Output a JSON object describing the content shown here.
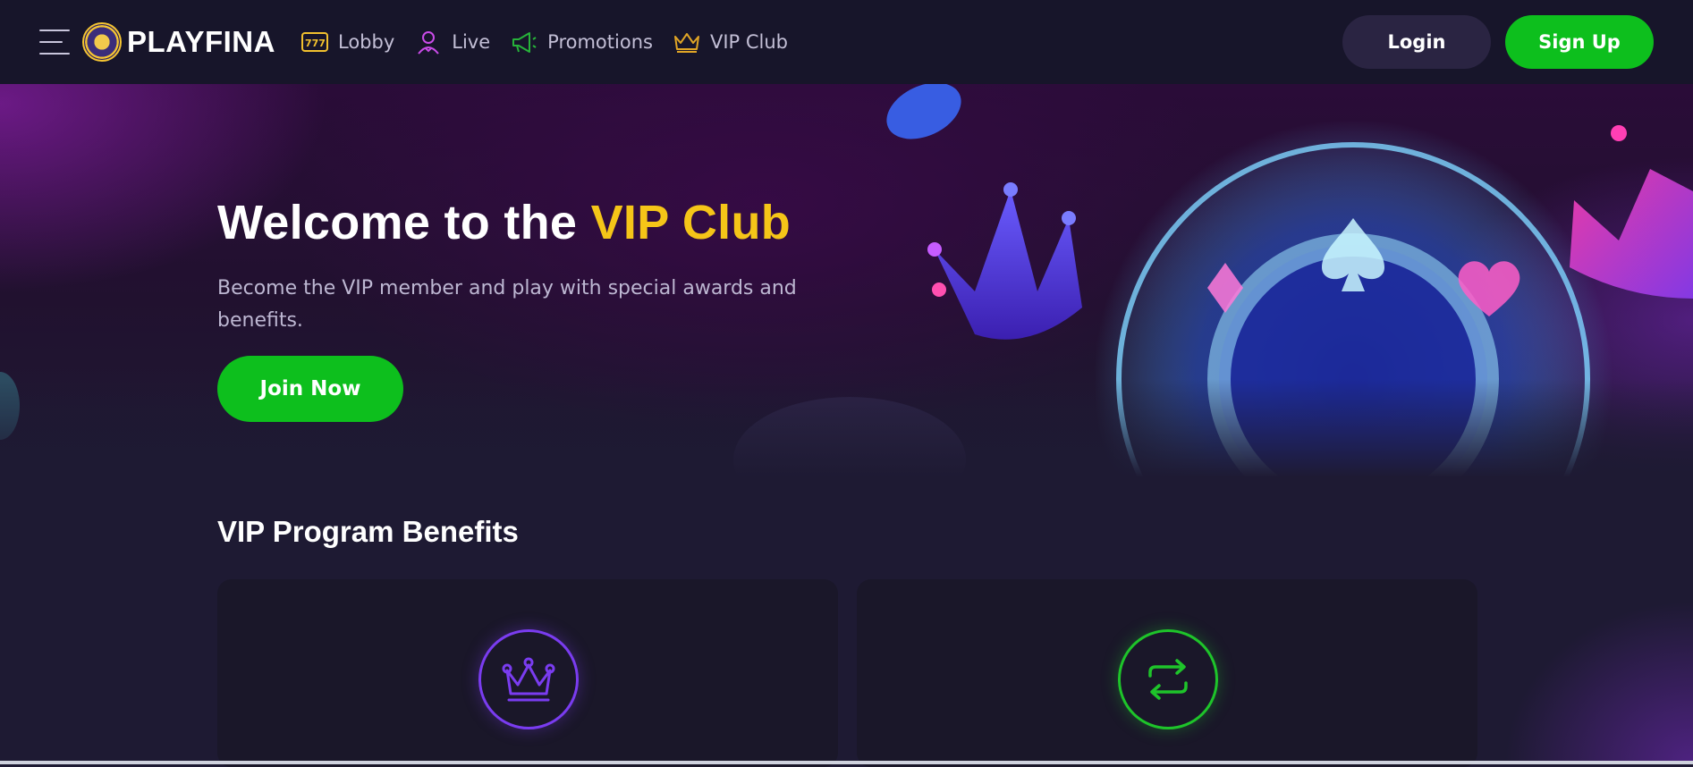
{
  "brand": {
    "name": "PLAYFINA"
  },
  "nav": {
    "items": [
      {
        "label": "Lobby",
        "icon": "slot-machine-icon",
        "color": "#f2c12e"
      },
      {
        "label": "Live",
        "icon": "dealer-icon",
        "color": "#c94be8"
      },
      {
        "label": "Promotions",
        "icon": "megaphone-icon",
        "color": "#27b33a"
      },
      {
        "label": "VIP Club",
        "icon": "crown-icon",
        "color": "#e0a526"
      }
    ]
  },
  "header": {
    "login_label": "Login",
    "signup_label": "Sign Up"
  },
  "hero": {
    "title_main": "Welcome to the ",
    "title_accent": "VIP Club",
    "subtitle": "Become the VIP member and play with special awards and benefits.",
    "cta_label": "Join Now"
  },
  "benefits": {
    "title": "VIP Program Benefits",
    "cards": [
      {
        "icon": "crown-icon",
        "color": "#7a3cf0"
      },
      {
        "icon": "exchange-arrows-icon",
        "color": "#1ec42a"
      }
    ]
  },
  "colors": {
    "header_bg": "#17152a",
    "accent_yellow": "#f5c518",
    "cta_green": "#0dbf1d",
    "page_bg": "#1e1a33"
  }
}
